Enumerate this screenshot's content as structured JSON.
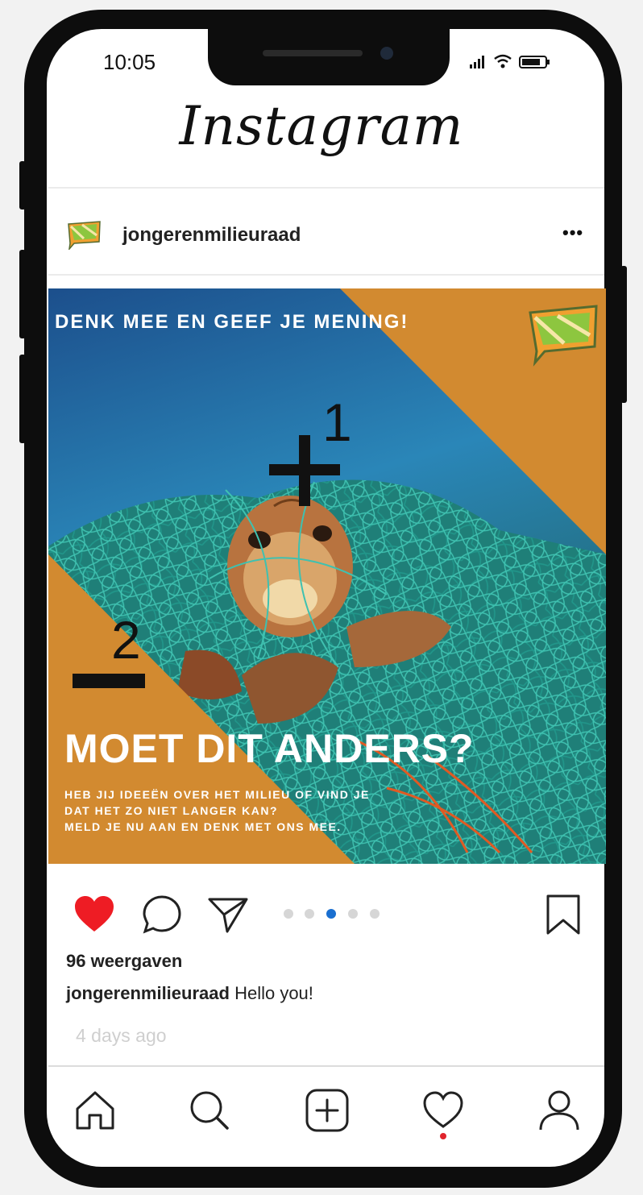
{
  "status_bar": {
    "time": "10:05"
  },
  "app": {
    "title": "Instagram"
  },
  "post": {
    "username": "jongerenmilieuraad",
    "more_label": "•••",
    "poster": {
      "heading": "DENK MEE EN GEEF JE MENING!",
      "title": "MOET DIT ANDERS?",
      "body_lines": [
        "HEB JIJ IDEEËN OVER HET MILIEU OF VIND JE",
        "DAT HET ZO NIET LANGER KAN?",
        "MELD JE NU AAN EN DENK MET ONS MEE."
      ],
      "plus_annotation": "1",
      "minus_annotation": "2",
      "colors": {
        "orange": "#d28a30",
        "sea": "#1f6fa5",
        "net": "#2aa79a"
      }
    },
    "actions": [
      "heart-icon",
      "comment-icon",
      "share-icon",
      "bookmark-icon"
    ],
    "carousel": {
      "total": 5,
      "active_index": 2,
      "active_color": "#1a6fd0"
    },
    "views": "96 weergaven",
    "caption": {
      "username": "jongerenmilieuraad",
      "text": "Hello you!"
    },
    "time_ago": "4 days ago"
  },
  "tab_bar": {
    "items": [
      "home-icon",
      "search-icon",
      "new-post-icon",
      "activity-icon",
      "profile-icon"
    ],
    "notification_color": "#e0242c"
  },
  "colors": {
    "like": "#ee1c24",
    "frame": "#0d0d0d"
  }
}
